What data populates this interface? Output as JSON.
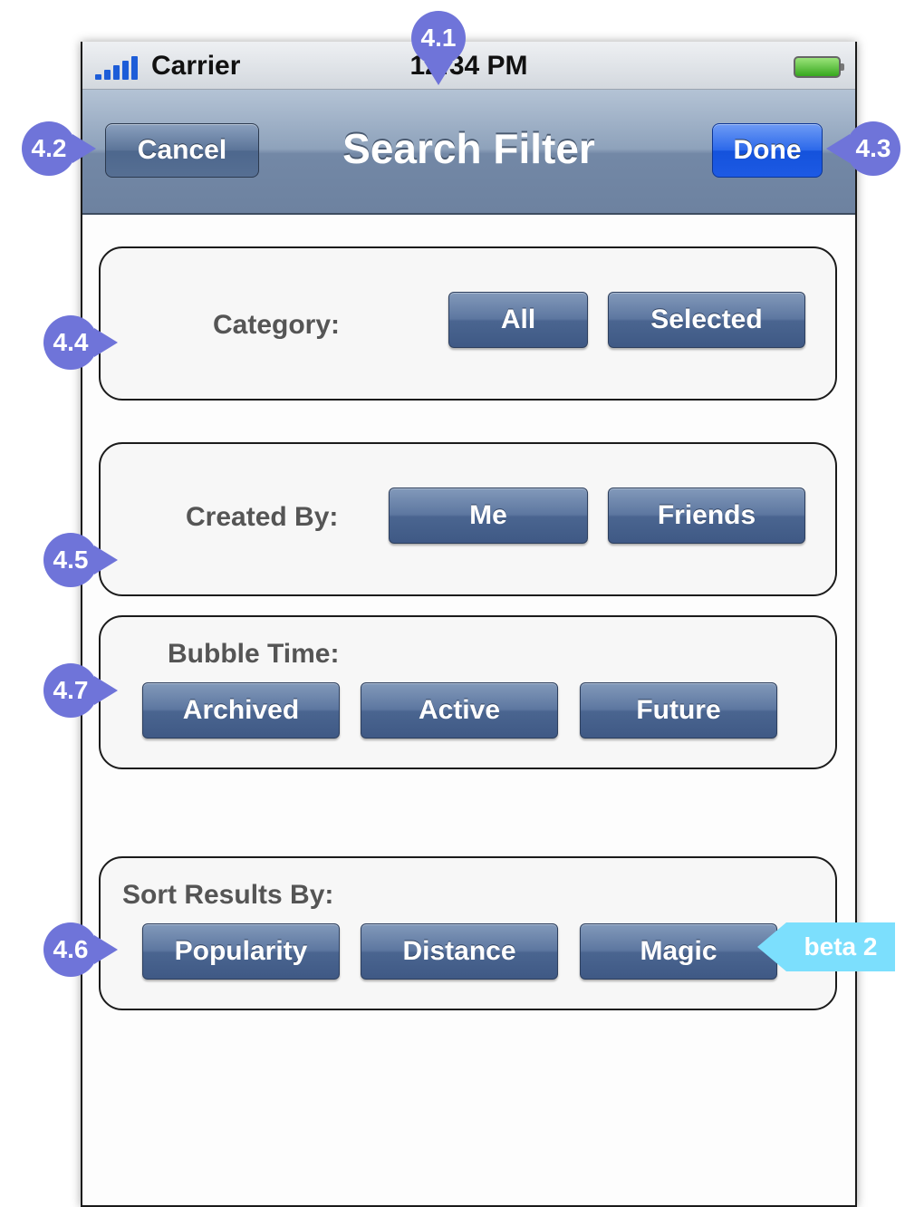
{
  "status_bar": {
    "carrier": "Carrier",
    "time": "12:34 PM"
  },
  "nav": {
    "title": "Search Filter",
    "cancel_label": "Cancel",
    "done_label": "Done"
  },
  "category": {
    "label": "Category:",
    "options": [
      "All",
      "Selected"
    ]
  },
  "created_by": {
    "label": "Created By:",
    "options": [
      "Me",
      "Friends"
    ]
  },
  "bubble_time": {
    "label": "Bubble Time:",
    "options": [
      "Archived",
      "Active",
      "Future"
    ]
  },
  "sort": {
    "label": "Sort Results By:",
    "options": [
      "Popularity",
      "Distance",
      "Magic"
    ]
  },
  "annotations": {
    "m41": "4.1",
    "m42": "4.2",
    "m43": "4.3",
    "m44": "4.4",
    "m45": "4.5",
    "m46": "4.6",
    "m47": "4.7",
    "beta": "beta 2"
  },
  "colors": {
    "accent_marker": "#6f74d9",
    "beta_note": "#7cdffd",
    "done_button": "#1d5ae4",
    "nav_bar": "#7388a6"
  }
}
